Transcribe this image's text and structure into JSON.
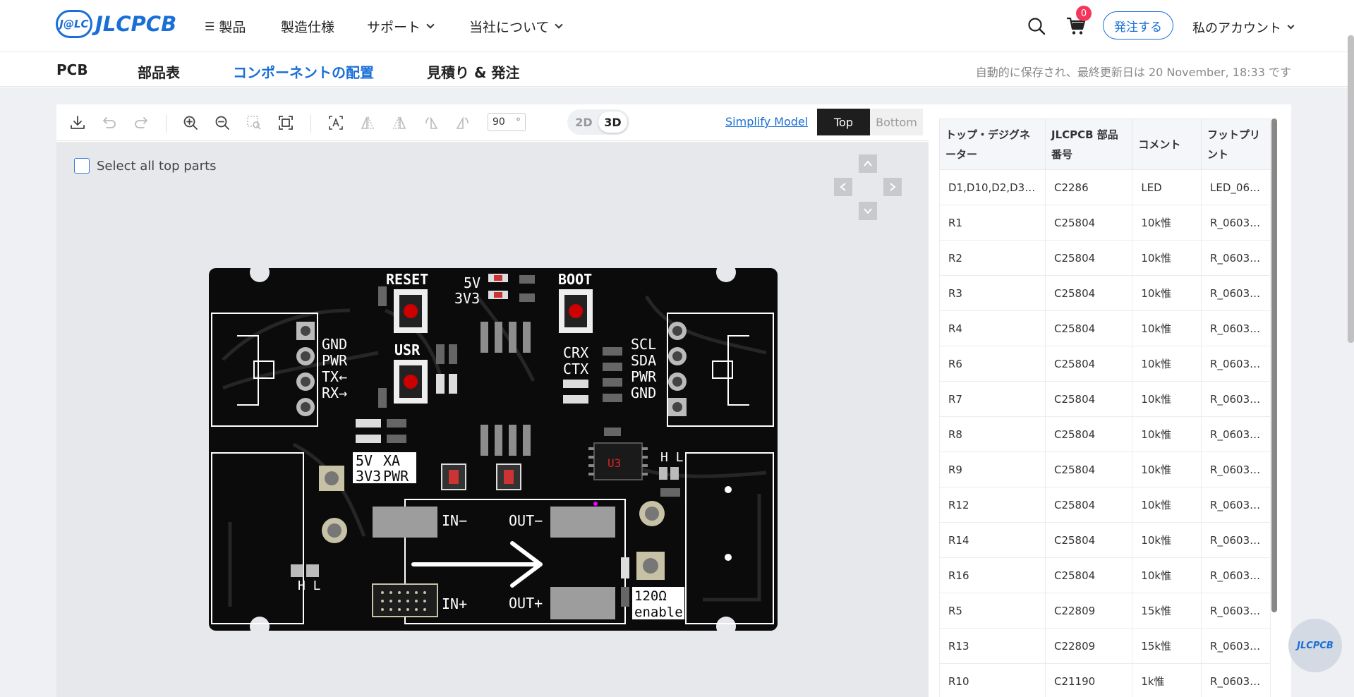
{
  "header": {
    "logo_badge": "J@LC",
    "logo_text": "JLCPCB",
    "nav": [
      {
        "label": "製品",
        "icon": "list-icon"
      },
      {
        "label": "製造仕様"
      },
      {
        "label": "サポート",
        "dropdown": true
      },
      {
        "label": "当社について",
        "dropdown": true
      }
    ],
    "cart_count": "0",
    "order_button": "発注する",
    "account": "私のアカウント"
  },
  "steps": {
    "items": [
      "PCB",
      "部品表",
      "コンポーネントの配置",
      "見積り & 発注"
    ],
    "active_index": 2,
    "saved_text": "自動的に保存され、最終更新日は 20 November, 18:33 です"
  },
  "toolbar": {
    "angle_value": "90",
    "angle_unit": "°",
    "mode_2d": "2D",
    "mode_3d": "3D",
    "simplify_label": "Simplify Model",
    "top_label": "Top",
    "bottom_label": "Bottom"
  },
  "canvas": {
    "select_all_label": "Select all top parts"
  },
  "pcb_labels": {
    "reset": "RESET",
    "boot": "BOOT",
    "usr": "USR",
    "v5": "5V",
    "v33": "3V3",
    "gnd": "GND",
    "pwr": "PWR",
    "tx": "TX←",
    "rx": "RX→",
    "scl": "SCL",
    "sda": "SDA",
    "pwr2": "PWR",
    "gnd2": "GND",
    "crx": "CRX",
    "ctx": "CTX",
    "v5b": "5V",
    "v33b": "3V3",
    "xa": "XA",
    "pwrb": "PWR",
    "hl1": "H L",
    "hl2": "H L",
    "in_minus": "IN−",
    "in_plus": "IN+",
    "out_minus": "OUT−",
    "out_plus": "OUT+",
    "ohm": "120Ω",
    "enable": "enable",
    "u3": "U3"
  },
  "bom_table": {
    "headers": [
      "トップ・デジグネーター",
      "JLCPCB 部品番号",
      "コメント",
      "フットプリント"
    ],
    "rows": [
      [
        "D1,D10,D2,D3,…",
        "C2286",
        "LED",
        "LED_06…"
      ],
      [
        "R1",
        "C25804",
        "10k惟",
        "R_0603…"
      ],
      [
        "R2",
        "C25804",
        "10k惟",
        "R_0603…"
      ],
      [
        "R3",
        "C25804",
        "10k惟",
        "R_0603…"
      ],
      [
        "R4",
        "C25804",
        "10k惟",
        "R_0603…"
      ],
      [
        "R6",
        "C25804",
        "10k惟",
        "R_0603…"
      ],
      [
        "R7",
        "C25804",
        "10k惟",
        "R_0603…"
      ],
      [
        "R8",
        "C25804",
        "10k惟",
        "R_0603…"
      ],
      [
        "R9",
        "C25804",
        "10k惟",
        "R_0603…"
      ],
      [
        "R12",
        "C25804",
        "10k惟",
        "R_0603…"
      ],
      [
        "R14",
        "C25804",
        "10k惟",
        "R_0603…"
      ],
      [
        "R16",
        "C25804",
        "10k惟",
        "R_0603…"
      ],
      [
        "R5",
        "C22809",
        "15k惟",
        "R_0603…"
      ],
      [
        "R13",
        "C22809",
        "15k惟",
        "R_0603…"
      ],
      [
        "R10",
        "C21190",
        "1k惟",
        "R_0603…"
      ]
    ]
  },
  "help_bubble": "JLCPCB",
  "colors": {
    "brand": "#1a6fd6",
    "badge": "#f5365c",
    "pcb": "#0b0b0b"
  }
}
